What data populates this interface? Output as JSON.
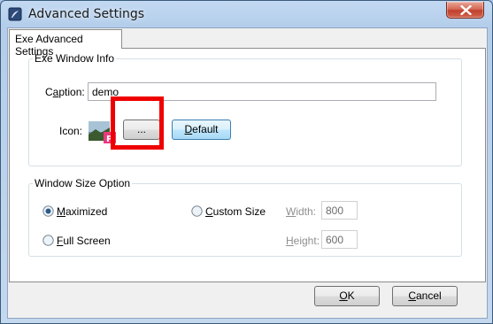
{
  "window": {
    "title": "Advanced Settings",
    "icon": "pdf-app-icon",
    "close_icon": "close-x-icon"
  },
  "tabs": [
    {
      "label": "Exe Advanced Settings",
      "selected": true
    }
  ],
  "exe_window_info": {
    "legend": "Exe Window Info",
    "caption_label_pre": "C",
    "caption_label_accel": "a",
    "caption_label_post": "ption:",
    "caption_value": "demo",
    "icon_label": "Icon:",
    "icon_preview": "exe-icon-preview",
    "browse_button": "...",
    "default_button_accel": "D",
    "default_button_post": "efault"
  },
  "window_size_option": {
    "legend": "Window Size Option",
    "maximized": {
      "accel": "M",
      "rest": "aximized",
      "checked": true
    },
    "full_screen": {
      "accel": "F",
      "rest": "ull Screen",
      "checked": false
    },
    "custom_size": {
      "accel": "C",
      "rest": "ustom Size",
      "checked": false
    },
    "width": {
      "accel": "W",
      "rest": "idth:",
      "value": "800",
      "enabled": false
    },
    "height": {
      "accel": "H",
      "rest": "eight:",
      "value": "600",
      "enabled": false
    }
  },
  "footer": {
    "ok_accel": "O",
    "ok_rest": "K",
    "cancel_accel": "C",
    "cancel_rest": "ancel"
  },
  "colors": {
    "highlight": "#ef0000",
    "title_bar": "#b3cdea",
    "close_button": "#c0402c"
  }
}
